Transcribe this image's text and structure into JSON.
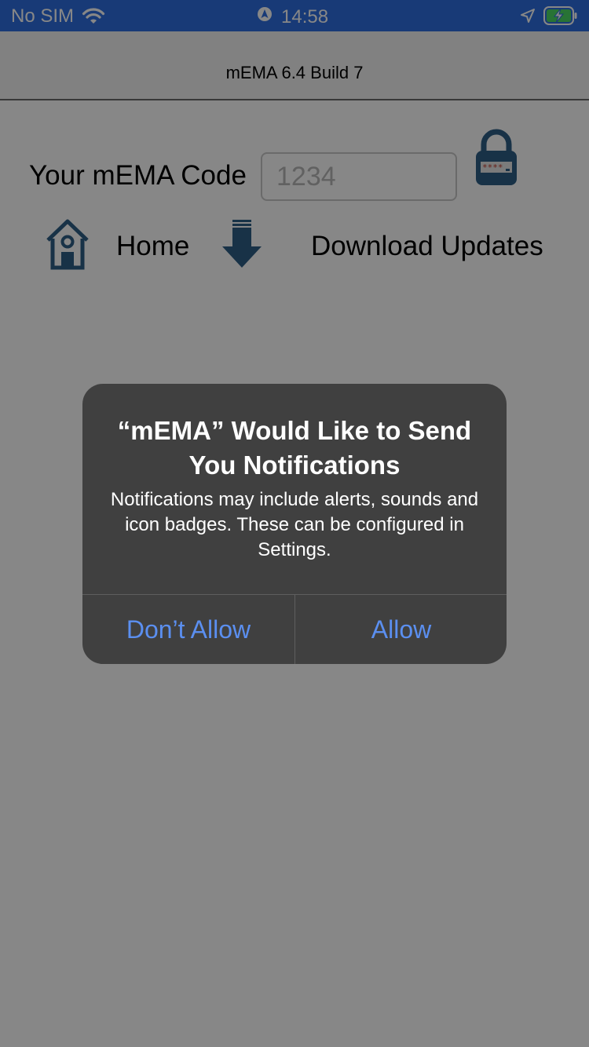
{
  "status_bar": {
    "carrier": "No SIM",
    "time": "14:58"
  },
  "app": {
    "nav_title": "mEMA 6.4 Build 7",
    "code_label": "Your mEMA Code",
    "code_placeholder": "1234",
    "home_label": "Home",
    "download_label": "Download Updates"
  },
  "alert": {
    "title": "“mEMA” Would Like to Send You Notifications",
    "message": "Notifications may include alerts, sounds and icon badges. These can be configured in Settings.",
    "dont_allow": "Don’t Allow",
    "allow": "Allow"
  },
  "colors": {
    "status_bar_bg": "#2e6fe0",
    "icon_blue": "#2f5f86",
    "alert_bg": "#404040",
    "alert_button_text": "#5b8ff0"
  },
  "icons": [
    "wifi-icon",
    "orientation-lock-icon",
    "location-arrow-icon",
    "battery-charging-icon",
    "lock-icon",
    "home-icon",
    "download-arrow-icon"
  ]
}
